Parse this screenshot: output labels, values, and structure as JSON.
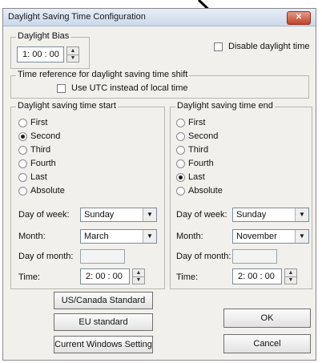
{
  "window": {
    "title": "Daylight Saving Time Configuration",
    "close_glyph": "✕"
  },
  "bias": {
    "legend": "Daylight Bias",
    "value": "1: 00 : 00"
  },
  "disable_daylight": {
    "label": "Disable daylight time",
    "checked": false
  },
  "time_reference": {
    "legend": "Time reference for daylight saving time shift",
    "utc_label": "Use UTC instead of local time",
    "utc_checked": false
  },
  "start": {
    "legend": "Daylight saving time start",
    "options": [
      "First",
      "Second",
      "Third",
      "Fourth",
      "Last",
      "Absolute"
    ],
    "selected": "Second",
    "dow_label": "Day of week:",
    "dow_value": "Sunday",
    "month_label": "Month:",
    "month_value": "March",
    "dom_label": "Day of month:",
    "dom_value": "",
    "time_label": "Time:",
    "time_value": "2: 00 : 00"
  },
  "end": {
    "legend": "Daylight saving time end",
    "options": [
      "First",
      "Second",
      "Third",
      "Fourth",
      "Last",
      "Absolute"
    ],
    "selected": "Last",
    "dow_label": "Day of week:",
    "dow_value": "Sunday",
    "month_label": "Month:",
    "month_value": "November",
    "dom_label": "Day of month:",
    "dom_value": "",
    "time_label": "Time:",
    "time_value": "2: 00 : 00"
  },
  "buttons": {
    "us_canada": "US/Canada Standard",
    "eu": "EU standard",
    "current_windows": "Current Windows Setting",
    "ok": "OK",
    "cancel": "Cancel"
  },
  "icons": {
    "annotation_arrow": "arrow-annotation-icon"
  }
}
